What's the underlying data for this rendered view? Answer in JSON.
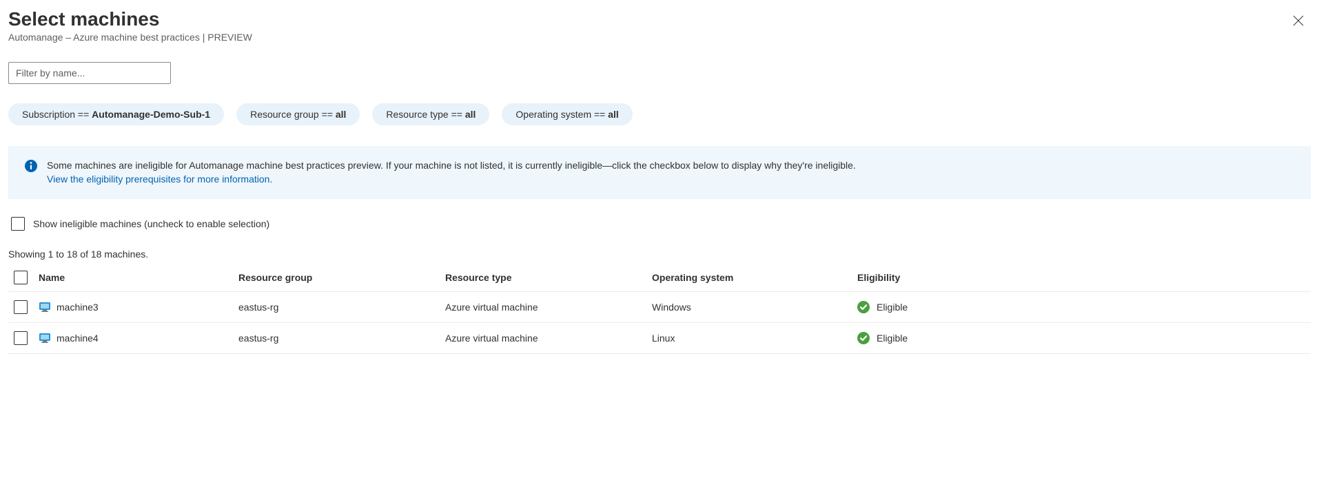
{
  "header": {
    "title": "Select machines",
    "subtitle": "Automanage – Azure machine best practices | PREVIEW"
  },
  "filter": {
    "placeholder": "Filter by name..."
  },
  "pills": {
    "subscription_label": "Subscription == ",
    "subscription_value": "Automanage-Demo-Sub-1",
    "resource_group_label": "Resource group == ",
    "resource_group_value": "all",
    "resource_type_label": "Resource type == ",
    "resource_type_value": "all",
    "os_label": "Operating system == ",
    "os_value": "all"
  },
  "banner": {
    "text": "Some machines are ineligible for Automanage machine best practices preview. If your machine is not listed, it is currently ineligible—click the checkbox below to display why they're ineligible.",
    "link": "View the eligibility prerequisites for more information."
  },
  "toggle": {
    "label": "Show ineligible machines (uncheck to enable selection)"
  },
  "count": {
    "text": "Showing 1 to 18 of 18 machines."
  },
  "columns": {
    "name": "Name",
    "resource_group": "Resource group",
    "resource_type": "Resource type",
    "os": "Operating system",
    "eligibility": "Eligibility"
  },
  "rows": [
    {
      "name": "machine3",
      "rg": "eastus-rg",
      "rt": "Azure virtual machine",
      "os": "Windows",
      "elig": "Eligible"
    },
    {
      "name": "machine4",
      "rg": "eastus-rg",
      "rt": "Azure virtual machine",
      "os": "Linux",
      "elig": "Eligible"
    }
  ]
}
